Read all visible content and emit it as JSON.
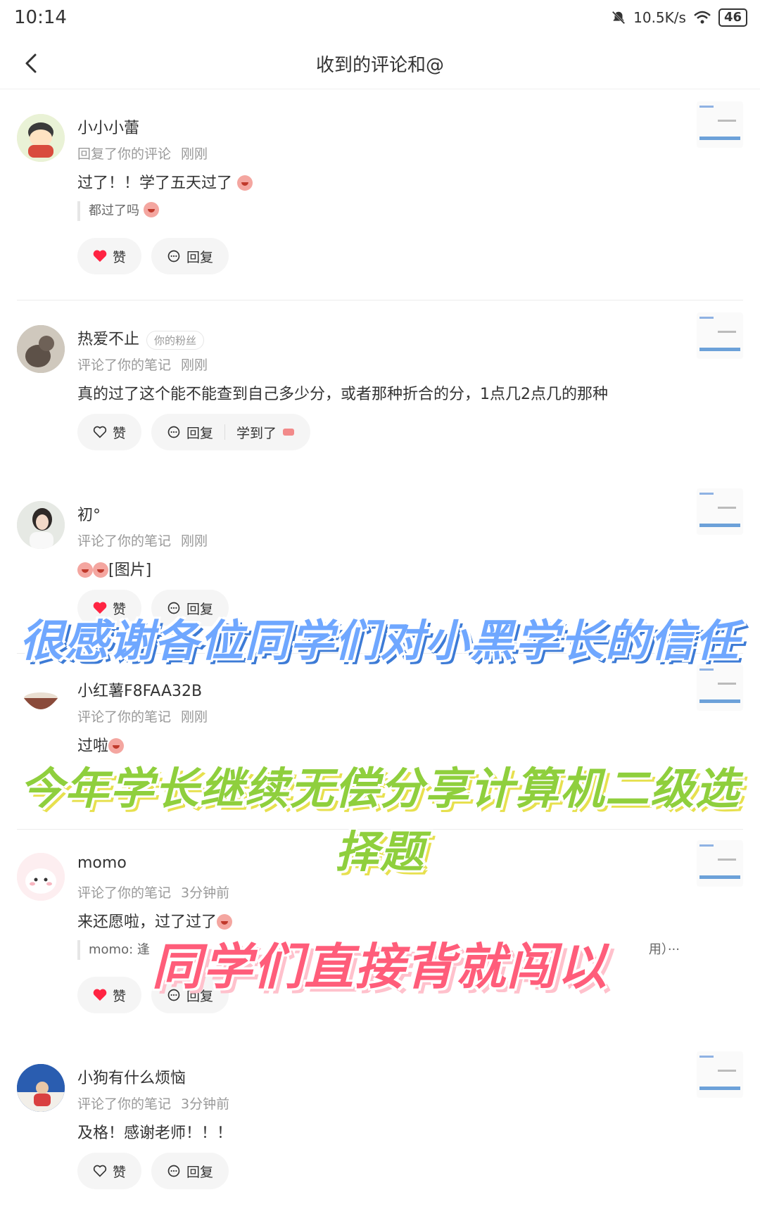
{
  "status_bar": {
    "time": "10:14",
    "network_speed": "10.5K/s",
    "battery": "46"
  },
  "header": {
    "title": "收到的评论和@"
  },
  "comments": [
    {
      "name": "小小小蕾",
      "badge": "",
      "action": "回复了你的评论",
      "time": "刚刚",
      "text": "过了！！学了五天过了",
      "quote": "都过了吗",
      "like_label": "赞",
      "liked": true,
      "reply_label": "回复",
      "extra_label": ""
    },
    {
      "name": "热爱不止",
      "badge": "你的粉丝",
      "action": "评论了你的笔记",
      "time": "刚刚",
      "text": "真的过了这个能不能查到自己多少分，或者那种折合的分，1点几2点几的那种",
      "quote": "",
      "like_label": "赞",
      "liked": false,
      "reply_label": "回复",
      "extra_label": "学到了"
    },
    {
      "name": "初°",
      "badge": "",
      "action": "评论了你的笔记",
      "time": "刚刚",
      "text": "[图片]",
      "quote": "",
      "like_label": "赞",
      "liked": true,
      "reply_label": "回复",
      "extra_label": ""
    },
    {
      "name": "小红薯F8FAA32B",
      "badge": "",
      "action": "评论了你的笔记",
      "time": "刚刚",
      "text": "过啦",
      "quote": "",
      "like_label": "赞",
      "liked": false,
      "reply_label": "回复",
      "extra_label": ""
    },
    {
      "name": "momo",
      "badge": "",
      "action": "评论了你的笔记",
      "time": "3分钟前",
      "text": "来还愿啦，过了过了",
      "quote": "momo: 逢",
      "quote_tail": "用）···",
      "like_label": "赞",
      "liked": true,
      "reply_label": "回复",
      "extra_label": ""
    },
    {
      "name": "小狗有什么烦恼",
      "badge": "",
      "action": "评论了你的笔记",
      "time": "3分钟前",
      "text": "及格！感谢老师！！！",
      "quote": "",
      "like_label": "赞",
      "liked": false,
      "reply_label": "回复",
      "extra_label": ""
    }
  ],
  "captions": {
    "line1": "很感谢各位同学们对小黑学长的信任",
    "line2": "今年学长继续无偿分享计算机二级选择题",
    "line3": "同学们直接背就闯以"
  },
  "colors": {
    "like_red": "#ff2442",
    "caption1": "#6fa7ff",
    "caption2": "#8fcf3d",
    "caption3": "#ff5d7a"
  }
}
